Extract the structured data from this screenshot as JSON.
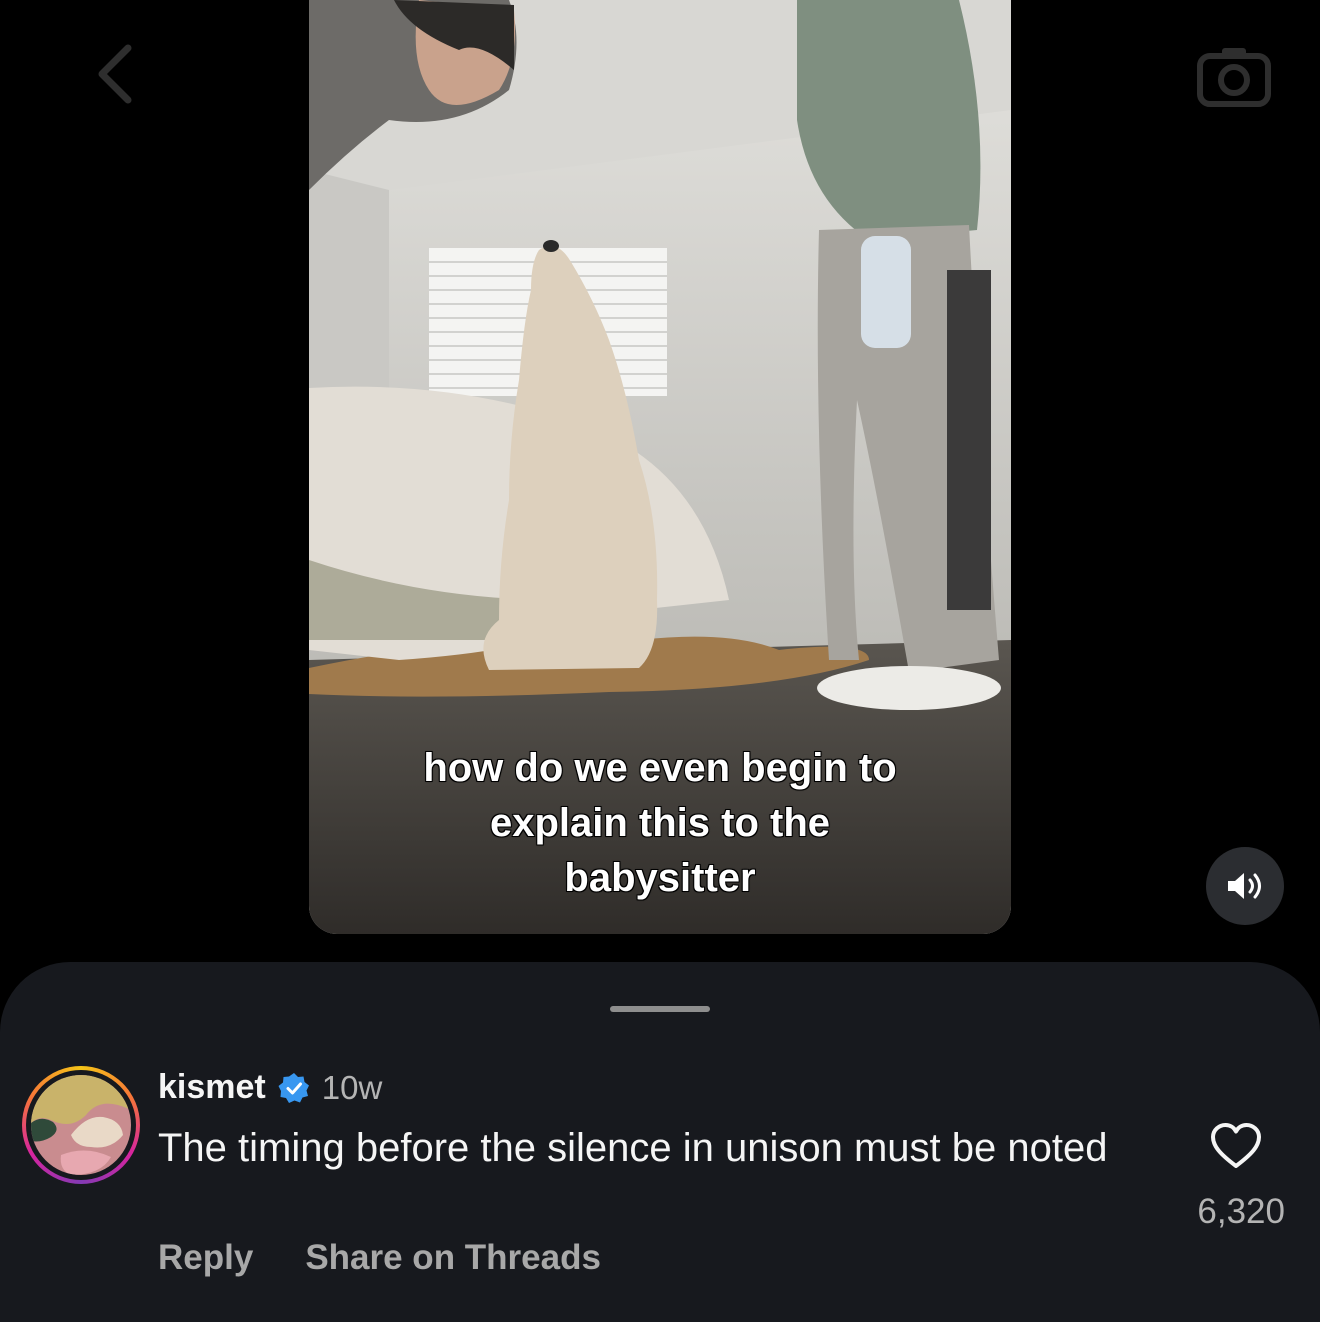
{
  "top_bar": {
    "back_icon": "chevron-left-icon",
    "camera_icon": "camera-icon"
  },
  "video": {
    "caption_lines": [
      "how do we even begin to",
      "explain this to the",
      "babysitter"
    ],
    "sound_icon": "speaker-on-icon"
  },
  "comment": {
    "username": "kismet",
    "verified_icon": "verified-badge-icon",
    "time": "10w",
    "text": "The timing before the silence in unison must be noted",
    "reply_label": "Reply",
    "share_label": "Share on Threads",
    "like_icon": "heart-outline-icon",
    "like_count": "6,320"
  },
  "colors": {
    "background": "#000000",
    "sheet": "#17191e",
    "verified": "#3897f0",
    "muted_text": "#a8a8a8"
  }
}
